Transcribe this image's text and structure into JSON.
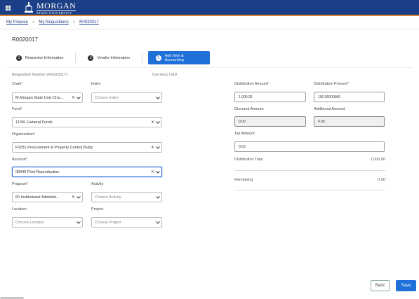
{
  "header": {
    "logo_main": "MORGAN",
    "logo_sub": "STATE UNIVERSITY",
    "brand_color": "#1b3f86",
    "accent_color": "#d9822b"
  },
  "breadcrumb": {
    "items": [
      "My Finance",
      "My Requisitions",
      "R0020017"
    ],
    "separator": "»"
  },
  "page_title": "R0020017",
  "steps": [
    {
      "num": "1",
      "label": "Requestor Information",
      "active": false
    },
    {
      "num": "2",
      "label": "Vendor Information",
      "active": false
    },
    {
      "num": "3",
      "label": "Add Item & Accounting",
      "active": true
    }
  ],
  "meta": {
    "requisition_number": "Requisition Number (R0020017)",
    "currency": "Currency USD"
  },
  "form": {
    "chart": {
      "label": "Chart",
      "value": "M Morgan State Univ Cha..."
    },
    "index": {
      "label": "Index",
      "placeholder": "Choose Index"
    },
    "fund": {
      "label": "Fund",
      "value": "11001 General Funds"
    },
    "organization": {
      "label": "Organization",
      "value": "F0231 Procurement & Property Control Budg"
    },
    "account": {
      "label": "Account",
      "value": "08040 Print Reproduction"
    },
    "program": {
      "label": "Program",
      "value": "60 Institutional Administ..."
    },
    "activity": {
      "label": "Activity",
      "placeholder": "Choose Activity"
    },
    "location": {
      "label": "Location",
      "placeholder": "Choose Location"
    },
    "project": {
      "label": "Project",
      "placeholder": "Choose Project"
    }
  },
  "amounts": {
    "distribution_amount": {
      "label": "Distribution Amount",
      "value": "1,000.00"
    },
    "distribution_percent": {
      "label": "Distribution Percent",
      "value": "100.00000000"
    },
    "discount_amount": {
      "label": "Discount Amount",
      "value": "0.00"
    },
    "additional_amount": {
      "label": "Additional Amount",
      "value": "0.00"
    },
    "tax_amount": {
      "label": "Tax Amount",
      "value": "0.00"
    },
    "distribution_total": {
      "label": "Distribution Total",
      "value": "1,000.00"
    },
    "remaining": {
      "label": "Remaining",
      "value": "0.00"
    }
  },
  "icons": {
    "menu": "grid-menu-icon",
    "clear": "✕",
    "chevron": "chevron-down-icon"
  },
  "buttons": {
    "back": "Back",
    "save": "Save"
  }
}
